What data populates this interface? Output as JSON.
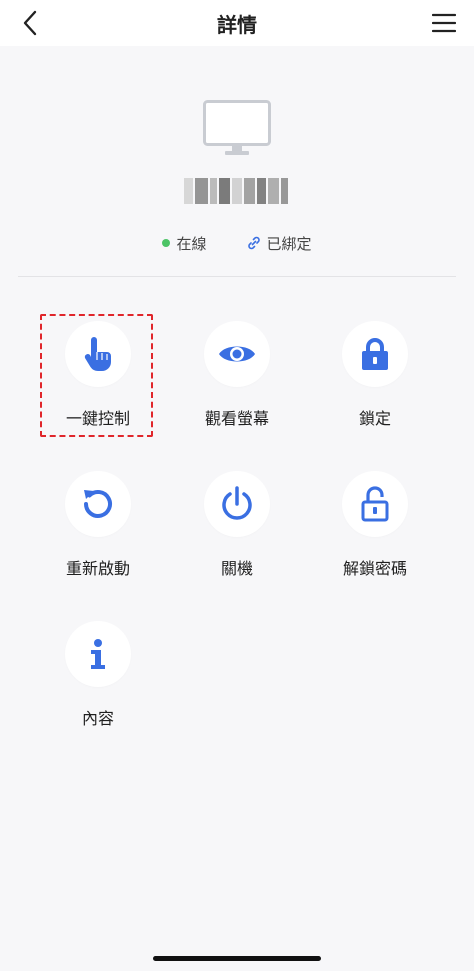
{
  "header": {
    "title": "詳情",
    "back_icon": "chevron-left-icon",
    "menu_icon": "hamburger-menu-icon"
  },
  "device": {
    "icon": "monitor-icon",
    "status_online": "在線",
    "status_bound": "已綁定",
    "online_color": "#4cc466"
  },
  "actions": [
    {
      "label": "一鍵控制",
      "icon": "hand-pointer-icon",
      "highlighted": true
    },
    {
      "label": "觀看螢幕",
      "icon": "eye-icon"
    },
    {
      "label": "鎖定",
      "icon": "lock-icon"
    },
    {
      "label": "重新啟動",
      "icon": "restart-icon"
    },
    {
      "label": "關機",
      "icon": "power-icon"
    },
    {
      "label": "解鎖密碼",
      "icon": "unlock-icon"
    },
    {
      "label": "內容",
      "icon": "info-icon"
    }
  ],
  "colors": {
    "accent": "#3a6fe2",
    "highlight_border": "#e0262b",
    "background": "#f7f7f9"
  }
}
